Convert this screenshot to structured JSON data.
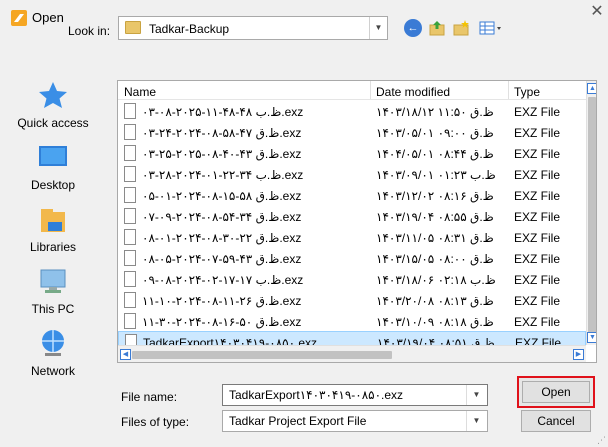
{
  "window": {
    "title": "Open",
    "close_glyph": "✕"
  },
  "toolbar": {
    "look_in_label": "Look in:",
    "look_in_value": "Tadkar-Backup",
    "dropdown_glyph": "▼",
    "icons": [
      "back-icon",
      "up-folder-icon",
      "new-folder-icon",
      "view-menu-icon"
    ]
  },
  "places": [
    {
      "label": "Quick access",
      "icon": "quick-access-icon"
    },
    {
      "label": "Desktop",
      "icon": "desktop-icon"
    },
    {
      "label": "Libraries",
      "icon": "libraries-icon"
    },
    {
      "label": "This PC",
      "icon": "this-pc-icon"
    },
    {
      "label": "Network",
      "icon": "network-icon"
    }
  ],
  "file_list": {
    "columns": [
      "Name",
      "Date modified",
      "Type"
    ],
    "rows": [
      {
        "name": "۰۳-۰۸-۲۰۲۵-۱۱-۴۸-۴۸ ظ.ب.exz",
        "date": "۱۴۰۳/۱۸/۱۲ ظ.ق ۱۱:۵۰",
        "type": "EXZ File"
      },
      {
        "name": "۰۳-۲۴-۲۰۲۴-۰۸-۵۸-۴۷ ظ.ق.exz",
        "date": "۱۴۰۳/۰۵/۰۱ ظ.ق ۰۹:۰۰",
        "type": "EXZ File"
      },
      {
        "name": "۰۳-۲۵-۲۰۲۵-۰۸-۴۰-۴۳ ظ.ق.exz",
        "date": "۱۴۰۴/۰۵/۰۱ ظ.ق ۰۸:۴۴",
        "type": "EXZ File"
      },
      {
        "name": "۰۳-۲۸-۲۰۲۴-۰۱-۲۲-۳۴ ظ.ب.exz",
        "date": "۱۴۰۳/۰۹/۰۱ ظ.ب ۰۱:۲۳",
        "type": "EXZ File"
      },
      {
        "name": "۰۵-۰۱-۲۰۲۴-۰۸-۱۵-۵۸ ظ.ق.exz",
        "date": "۱۴۰۳/۱۲/۰۲ ظ.ق ۰۸:۱۶",
        "type": "EXZ File"
      },
      {
        "name": "۰۷-۰۹-۲۰۲۴-۰۸-۵۴-۳۴ ظ.ق.exz",
        "date": "۱۴۰۳/۱۹/۰۴ ظ.ق ۰۸:۵۵",
        "type": "EXZ File"
      },
      {
        "name": "۰۸-۰۱-۲۰۲۴-۰۸-۳۰-۲۲ ظ.ق.exz",
        "date": "۱۴۰۳/۱۱/۰۵ ظ.ق ۰۸:۳۱",
        "type": "EXZ File"
      },
      {
        "name": "۰۸-۰۵-۲۰۲۴-۰۷-۵۹-۴۳ ظ.ق.exz",
        "date": "۱۴۰۳/۱۵/۰۵ ظ.ق ۰۸:۰۰",
        "type": "EXZ File"
      },
      {
        "name": "۰۹-۰۸-۲۰۲۴-۰۲-۱۷-۱۷ ظ.ب.exz",
        "date": "۱۴۰۳/۱۸/۰۶ ظ.ب ۰۲:۱۸",
        "type": "EXZ File"
      },
      {
        "name": "۱۱-۱۰-۲۰۲۴-۰۸-۱۱-۲۶ ظ.ق.exz",
        "date": "۱۴۰۳/۲۰/۰۸ ظ.ق ۰۸:۱۳",
        "type": "EXZ File"
      },
      {
        "name": "۱۱-۳۰-۲۰۲۴-۰۸-۱۶-۵۰ ظ.ق.exz",
        "date": "۱۴۰۳/۱۰/۰۹ ظ.ق ۰۸:۱۸",
        "type": "EXZ File"
      },
      {
        "name": "TadkarExport۱۴۰۳۰۴۱۹-۰۸۵۰.exz",
        "date": "۱۴۰۳/۱۹/۰۴ ظ.ق ۰۸:۵۱",
        "type": "EXZ File"
      }
    ]
  },
  "form": {
    "file_name_label": "File name:",
    "file_name_value": "TadkarExport۱۴۰۳۰۴۱۹-۰۸۵۰.exz",
    "file_type_label": "Files of type:",
    "file_type_value": "Tadkar Project Export File"
  },
  "buttons": {
    "open": "Open",
    "cancel": "Cancel"
  },
  "colors": {
    "highlight_border": "#e0111a",
    "selection": "#cce8ff",
    "accent": "#3a7bd5"
  }
}
